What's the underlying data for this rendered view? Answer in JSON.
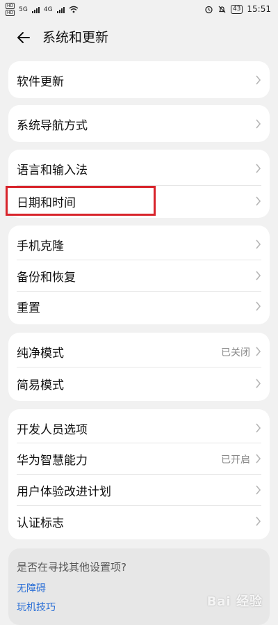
{
  "status_bar": {
    "hd1": "HD",
    "hd2": "HD",
    "net1": "5G",
    "net2": "4G",
    "battery": "43",
    "time": "15:51"
  },
  "header": {
    "title": "系统和更新"
  },
  "items": {
    "software_update": "软件更新",
    "nav_mode": "系统导航方式",
    "language_input": "语言和输入法",
    "date_time": "日期和时间",
    "phone_clone": "手机克隆",
    "backup_restore": "备份和恢复",
    "reset": "重置",
    "pure_mode": "纯净模式",
    "pure_mode_value": "已关闭",
    "simple_mode": "简易模式",
    "developer_options": "开发人员选项",
    "huawei_ai": "华为智慧能力",
    "huawei_ai_value": "已开启",
    "ux_plan": "用户体验改进计划",
    "certification": "认证标志"
  },
  "suggest": {
    "question": "是否在寻找其他设置项?",
    "link1": "无障碍",
    "link2": "玩机技巧"
  },
  "watermark": "Bai 经验",
  "colors": {
    "highlight": "#d8242b",
    "link": "#2b6fd6"
  }
}
